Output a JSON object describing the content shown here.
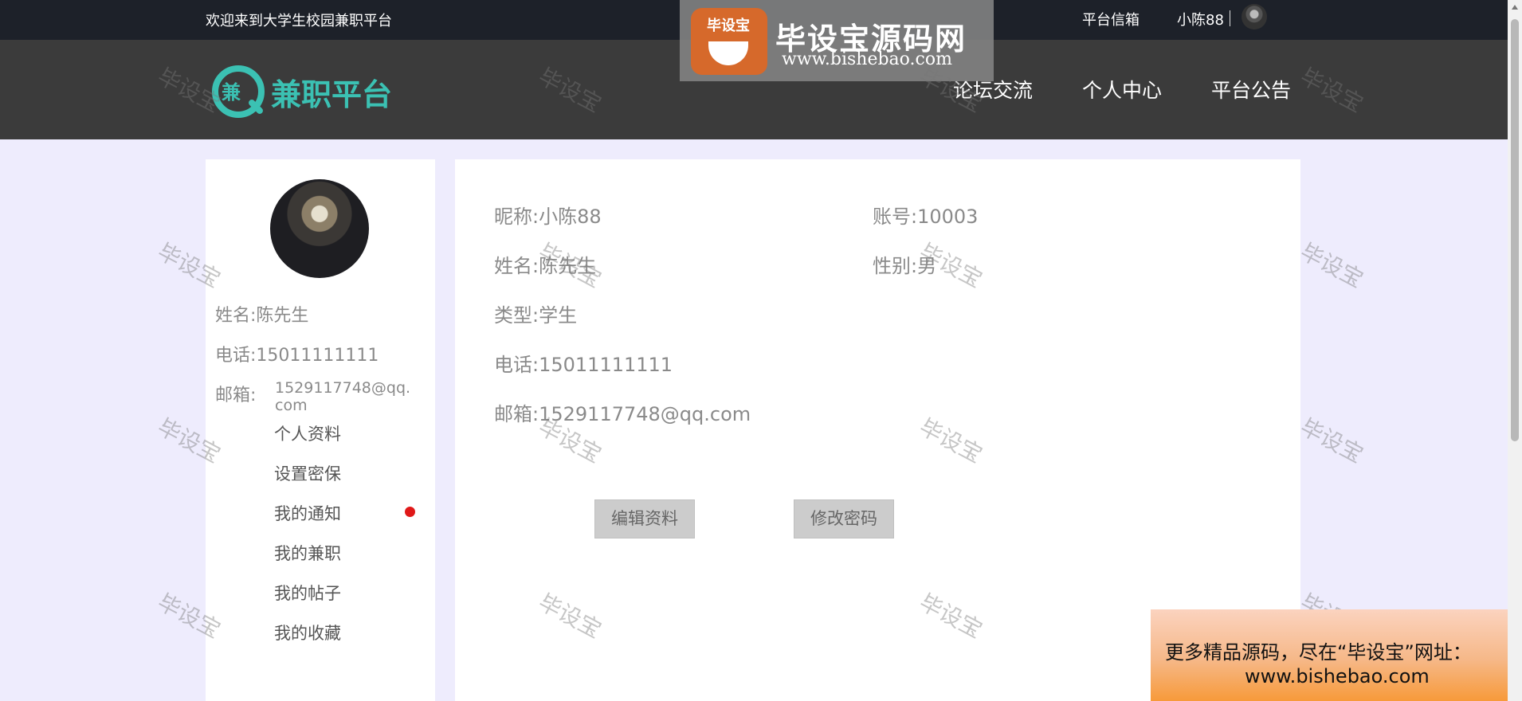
{
  "topbar": {
    "welcome": "欢迎来到大学生校园兼职平台",
    "mailbox": "平台信箱",
    "username": "小陈88"
  },
  "header": {
    "logo_char": "兼",
    "brand": "兼职平台",
    "nav": [
      "论坛交流",
      "个人中心",
      "平台公告"
    ]
  },
  "watermark_logo": {
    "badge": "毕设宝",
    "title": "毕设宝源码网",
    "url": "www.bishebao.com"
  },
  "sidebar": {
    "name_label": "姓名:",
    "name": "陈先生",
    "phone_label": "电话:",
    "phone": "15011111111",
    "email_label": "邮箱:",
    "email": "1529117748@qq.com",
    "menu": [
      "个人资料",
      "设置密保",
      "我的通知",
      "我的兼职",
      "我的帖子",
      "我的收藏"
    ]
  },
  "profile": {
    "nickname_label": "昵称:",
    "nickname": "小陈88",
    "account_label": "账号:",
    "account": "10003",
    "name_label": "姓名:",
    "name": "陈先生",
    "gender_label": "性别:",
    "gender": "男",
    "type_label": "类型:",
    "type": "学生",
    "phone_label": "电话:",
    "phone": "15011111111",
    "email_label": "邮箱:",
    "email": "1529117748@qq.com",
    "edit_button": "编辑资料",
    "password_button": "修改密码"
  },
  "watermark_text": "毕设宝",
  "promo": {
    "line1": "更多精品源码，尽在“毕设宝”网址：",
    "line2": "www.bishebao.com"
  },
  "colors": {
    "accent": "#3bc1b3",
    "topbar": "#1d2129",
    "header": "#3b3b3b",
    "page_bg": "#eeecfd",
    "notice_dot": "#e01818"
  }
}
